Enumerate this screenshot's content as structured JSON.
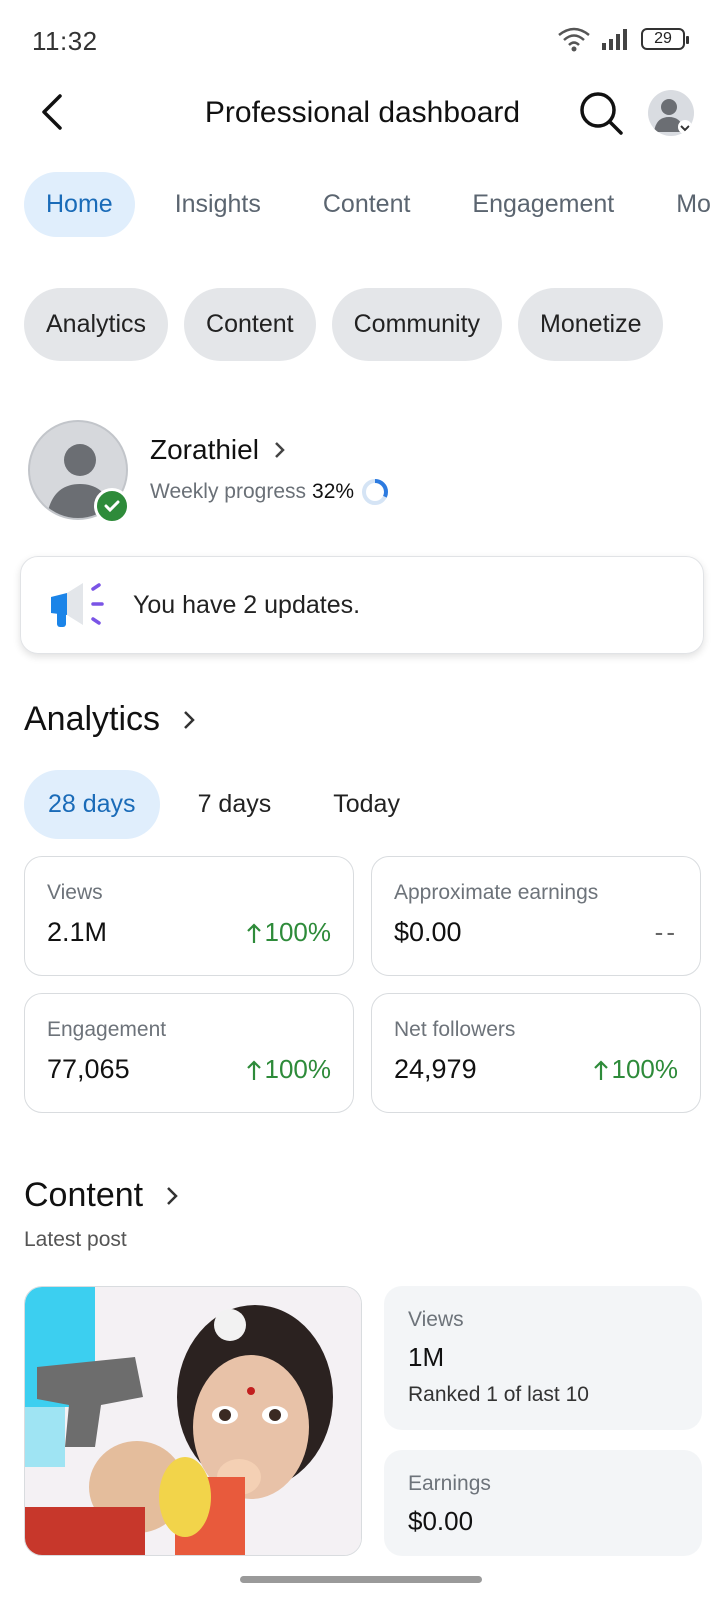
{
  "status_bar": {
    "time": "11:32",
    "battery": "29"
  },
  "topbar": {
    "title": "Professional dashboard"
  },
  "tabs": [
    {
      "label": "Home"
    },
    {
      "label": "Insights"
    },
    {
      "label": "Content"
    },
    {
      "label": "Engagement"
    },
    {
      "label": "Mo"
    }
  ],
  "chips": [
    {
      "label": "Analytics"
    },
    {
      "label": "Content"
    },
    {
      "label": "Community"
    },
    {
      "label": "Monetize"
    }
  ],
  "profile": {
    "name": "Zorathiel",
    "progress_label": "Weekly progress",
    "progress_value": "32%",
    "progress_fraction": 0.32
  },
  "updates": {
    "text": "You have 2 updates."
  },
  "analytics": {
    "title": "Analytics",
    "ranges": [
      {
        "label": "28 days"
      },
      {
        "label": "7 days"
      },
      {
        "label": "Today"
      }
    ],
    "metrics": [
      {
        "label": "Views",
        "value": "2.1M",
        "change": "100%"
      },
      {
        "label": "Approximate earnings",
        "value": "$0.00",
        "change": "--"
      },
      {
        "label": "Engagement",
        "value": "77,065",
        "change": "100%"
      },
      {
        "label": "Net followers",
        "value": "24,979",
        "change": "100%"
      }
    ]
  },
  "content": {
    "title": "Content",
    "latest_label": "Latest post",
    "views": {
      "label": "Views",
      "value": "1M",
      "sub": "Ranked 1 of last 10"
    },
    "earnings": {
      "label": "Earnings",
      "value": "$0.00"
    }
  },
  "colors": {
    "accent": "#1a6bb8",
    "accent_bg": "#e0eefc",
    "positive": "#2e8b3a"
  }
}
